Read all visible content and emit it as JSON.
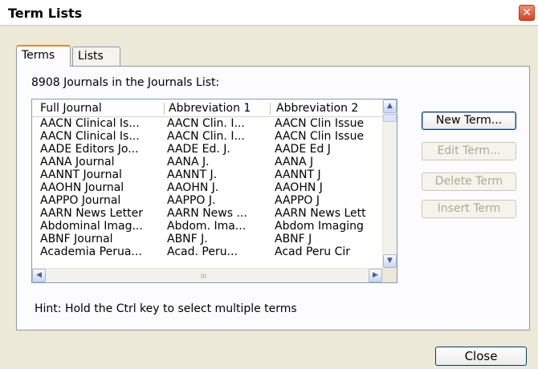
{
  "window": {
    "title": "Term Lists",
    "close_glyph": "✕"
  },
  "tabs": [
    {
      "label": "Terms",
      "active": true
    },
    {
      "label": "Lists",
      "active": false
    }
  ],
  "count_text": "8908 Journals in the Journals List:",
  "list": {
    "columns": [
      "Full Journal",
      "Abbreviation 1",
      "Abbreviation 2"
    ],
    "rows": [
      [
        "AACN Clinical Is...",
        "AACN Clin. I...",
        "AACN Clin Issue"
      ],
      [
        "AACN Clinical Is...",
        "AACN Clin. I...",
        "AACN Clin Issue"
      ],
      [
        "AADE Editors Jo...",
        "AADE Ed. J.",
        "AADE Ed J"
      ],
      [
        "AANA Journal",
        "AANA J.",
        "AANA J"
      ],
      [
        "AANNT Journal",
        "AANNT J.",
        "AANNT J"
      ],
      [
        "AAOHN Journal",
        "AAOHN J.",
        "AAOHN J"
      ],
      [
        "AAPPO Journal",
        "AAPPO J.",
        "AAPPO J"
      ],
      [
        "AARN News Letter",
        "AARN News ...",
        "AARN News Lett"
      ],
      [
        "Abdominal Imag...",
        "Abdom. Ima...",
        "Abdom Imaging"
      ],
      [
        "ABNF Journal",
        "ABNF J.",
        "ABNF J"
      ],
      [
        "Academia Perua...",
        "Acad. Peru...",
        "Acad Peru Cir"
      ]
    ],
    "scroll_icons": {
      "up": "▲",
      "down": "▼",
      "left": "◀",
      "right": "▶",
      "grip": "III"
    }
  },
  "buttons": {
    "new_term": {
      "label": "New Term...",
      "enabled": true
    },
    "edit_term": {
      "label": "Edit Term...",
      "enabled": false
    },
    "delete_term": {
      "label": "Delete Term",
      "enabled": false
    },
    "insert_term": {
      "label": "Insert Term",
      "enabled": false
    }
  },
  "hint": "Hint: Hold the Ctrl key to select multiple terms",
  "close_button": "Close",
  "colors": {
    "tab_accent": "#e68b2c",
    "button_border": "#003c74",
    "close_red": "#d9431f"
  }
}
